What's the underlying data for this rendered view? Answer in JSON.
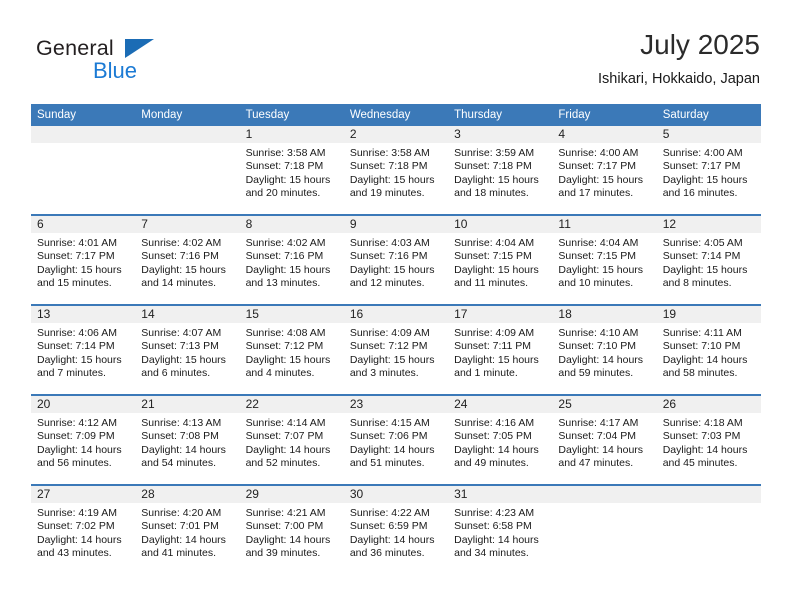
{
  "logo": {
    "word_top": "General",
    "word_bottom": "Blue",
    "triangle_color": "#1b6cb5",
    "blue_color": "#1b7ad4",
    "icon": "general-blue-logo"
  },
  "header": {
    "title": "July 2025",
    "subtitle": "Ishikari, Hokkaido, Japan"
  },
  "theme": {
    "header_blue": "#3b79b8",
    "band_gray": "#f0f0f0",
    "text": "#1a1a1a"
  },
  "weekday_headers": [
    "Sunday",
    "Monday",
    "Tuesday",
    "Wednesday",
    "Thursday",
    "Friday",
    "Saturday"
  ],
  "labels": {
    "sunrise_prefix": "Sunrise:",
    "sunset_prefix": "Sunset:",
    "daylight_prefix": "Daylight:"
  },
  "weeks": [
    [
      {
        "day": "",
        "sunrise": "",
        "sunset": "",
        "daylight_line1": "",
        "daylight_line2": ""
      },
      {
        "day": "",
        "sunrise": "",
        "sunset": "",
        "daylight_line1": "",
        "daylight_line2": ""
      },
      {
        "day": "1",
        "sunrise": "Sunrise: 3:58 AM",
        "sunset": "Sunset: 7:18 PM",
        "daylight_line1": "Daylight: 15 hours",
        "daylight_line2": "and 20 minutes."
      },
      {
        "day": "2",
        "sunrise": "Sunrise: 3:58 AM",
        "sunset": "Sunset: 7:18 PM",
        "daylight_line1": "Daylight: 15 hours",
        "daylight_line2": "and 19 minutes."
      },
      {
        "day": "3",
        "sunrise": "Sunrise: 3:59 AM",
        "sunset": "Sunset: 7:18 PM",
        "daylight_line1": "Daylight: 15 hours",
        "daylight_line2": "and 18 minutes."
      },
      {
        "day": "4",
        "sunrise": "Sunrise: 4:00 AM",
        "sunset": "Sunset: 7:17 PM",
        "daylight_line1": "Daylight: 15 hours",
        "daylight_line2": "and 17 minutes."
      },
      {
        "day": "5",
        "sunrise": "Sunrise: 4:00 AM",
        "sunset": "Sunset: 7:17 PM",
        "daylight_line1": "Daylight: 15 hours",
        "daylight_line2": "and 16 minutes."
      }
    ],
    [
      {
        "day": "6",
        "sunrise": "Sunrise: 4:01 AM",
        "sunset": "Sunset: 7:17 PM",
        "daylight_line1": "Daylight: 15 hours",
        "daylight_line2": "and 15 minutes."
      },
      {
        "day": "7",
        "sunrise": "Sunrise: 4:02 AM",
        "sunset": "Sunset: 7:16 PM",
        "daylight_line1": "Daylight: 15 hours",
        "daylight_line2": "and 14 minutes."
      },
      {
        "day": "8",
        "sunrise": "Sunrise: 4:02 AM",
        "sunset": "Sunset: 7:16 PM",
        "daylight_line1": "Daylight: 15 hours",
        "daylight_line2": "and 13 minutes."
      },
      {
        "day": "9",
        "sunrise": "Sunrise: 4:03 AM",
        "sunset": "Sunset: 7:16 PM",
        "daylight_line1": "Daylight: 15 hours",
        "daylight_line2": "and 12 minutes."
      },
      {
        "day": "10",
        "sunrise": "Sunrise: 4:04 AM",
        "sunset": "Sunset: 7:15 PM",
        "daylight_line1": "Daylight: 15 hours",
        "daylight_line2": "and 11 minutes."
      },
      {
        "day": "11",
        "sunrise": "Sunrise: 4:04 AM",
        "sunset": "Sunset: 7:15 PM",
        "daylight_line1": "Daylight: 15 hours",
        "daylight_line2": "and 10 minutes."
      },
      {
        "day": "12",
        "sunrise": "Sunrise: 4:05 AM",
        "sunset": "Sunset: 7:14 PM",
        "daylight_line1": "Daylight: 15 hours",
        "daylight_line2": "and 8 minutes."
      }
    ],
    [
      {
        "day": "13",
        "sunrise": "Sunrise: 4:06 AM",
        "sunset": "Sunset: 7:14 PM",
        "daylight_line1": "Daylight: 15 hours",
        "daylight_line2": "and 7 minutes."
      },
      {
        "day": "14",
        "sunrise": "Sunrise: 4:07 AM",
        "sunset": "Sunset: 7:13 PM",
        "daylight_line1": "Daylight: 15 hours",
        "daylight_line2": "and 6 minutes."
      },
      {
        "day": "15",
        "sunrise": "Sunrise: 4:08 AM",
        "sunset": "Sunset: 7:12 PM",
        "daylight_line1": "Daylight: 15 hours",
        "daylight_line2": "and 4 minutes."
      },
      {
        "day": "16",
        "sunrise": "Sunrise: 4:09 AM",
        "sunset": "Sunset: 7:12 PM",
        "daylight_line1": "Daylight: 15 hours",
        "daylight_line2": "and 3 minutes."
      },
      {
        "day": "17",
        "sunrise": "Sunrise: 4:09 AM",
        "sunset": "Sunset: 7:11 PM",
        "daylight_line1": "Daylight: 15 hours",
        "daylight_line2": "and 1 minute."
      },
      {
        "day": "18",
        "sunrise": "Sunrise: 4:10 AM",
        "sunset": "Sunset: 7:10 PM",
        "daylight_line1": "Daylight: 14 hours",
        "daylight_line2": "and 59 minutes."
      },
      {
        "day": "19",
        "sunrise": "Sunrise: 4:11 AM",
        "sunset": "Sunset: 7:10 PM",
        "daylight_line1": "Daylight: 14 hours",
        "daylight_line2": "and 58 minutes."
      }
    ],
    [
      {
        "day": "20",
        "sunrise": "Sunrise: 4:12 AM",
        "sunset": "Sunset: 7:09 PM",
        "daylight_line1": "Daylight: 14 hours",
        "daylight_line2": "and 56 minutes."
      },
      {
        "day": "21",
        "sunrise": "Sunrise: 4:13 AM",
        "sunset": "Sunset: 7:08 PM",
        "daylight_line1": "Daylight: 14 hours",
        "daylight_line2": "and 54 minutes."
      },
      {
        "day": "22",
        "sunrise": "Sunrise: 4:14 AM",
        "sunset": "Sunset: 7:07 PM",
        "daylight_line1": "Daylight: 14 hours",
        "daylight_line2": "and 52 minutes."
      },
      {
        "day": "23",
        "sunrise": "Sunrise: 4:15 AM",
        "sunset": "Sunset: 7:06 PM",
        "daylight_line1": "Daylight: 14 hours",
        "daylight_line2": "and 51 minutes."
      },
      {
        "day": "24",
        "sunrise": "Sunrise: 4:16 AM",
        "sunset": "Sunset: 7:05 PM",
        "daylight_line1": "Daylight: 14 hours",
        "daylight_line2": "and 49 minutes."
      },
      {
        "day": "25",
        "sunrise": "Sunrise: 4:17 AM",
        "sunset": "Sunset: 7:04 PM",
        "daylight_line1": "Daylight: 14 hours",
        "daylight_line2": "and 47 minutes."
      },
      {
        "day": "26",
        "sunrise": "Sunrise: 4:18 AM",
        "sunset": "Sunset: 7:03 PM",
        "daylight_line1": "Daylight: 14 hours",
        "daylight_line2": "and 45 minutes."
      }
    ],
    [
      {
        "day": "27",
        "sunrise": "Sunrise: 4:19 AM",
        "sunset": "Sunset: 7:02 PM",
        "daylight_line1": "Daylight: 14 hours",
        "daylight_line2": "and 43 minutes."
      },
      {
        "day": "28",
        "sunrise": "Sunrise: 4:20 AM",
        "sunset": "Sunset: 7:01 PM",
        "daylight_line1": "Daylight: 14 hours",
        "daylight_line2": "and 41 minutes."
      },
      {
        "day": "29",
        "sunrise": "Sunrise: 4:21 AM",
        "sunset": "Sunset: 7:00 PM",
        "daylight_line1": "Daylight: 14 hours",
        "daylight_line2": "and 39 minutes."
      },
      {
        "day": "30",
        "sunrise": "Sunrise: 4:22 AM",
        "sunset": "Sunset: 6:59 PM",
        "daylight_line1": "Daylight: 14 hours",
        "daylight_line2": "and 36 minutes."
      },
      {
        "day": "31",
        "sunrise": "Sunrise: 4:23 AM",
        "sunset": "Sunset: 6:58 PM",
        "daylight_line1": "Daylight: 14 hours",
        "daylight_line2": "and 34 minutes."
      },
      {
        "day": "",
        "sunrise": "",
        "sunset": "",
        "daylight_line1": "",
        "daylight_line2": ""
      },
      {
        "day": "",
        "sunrise": "",
        "sunset": "",
        "daylight_line1": "",
        "daylight_line2": ""
      }
    ]
  ]
}
